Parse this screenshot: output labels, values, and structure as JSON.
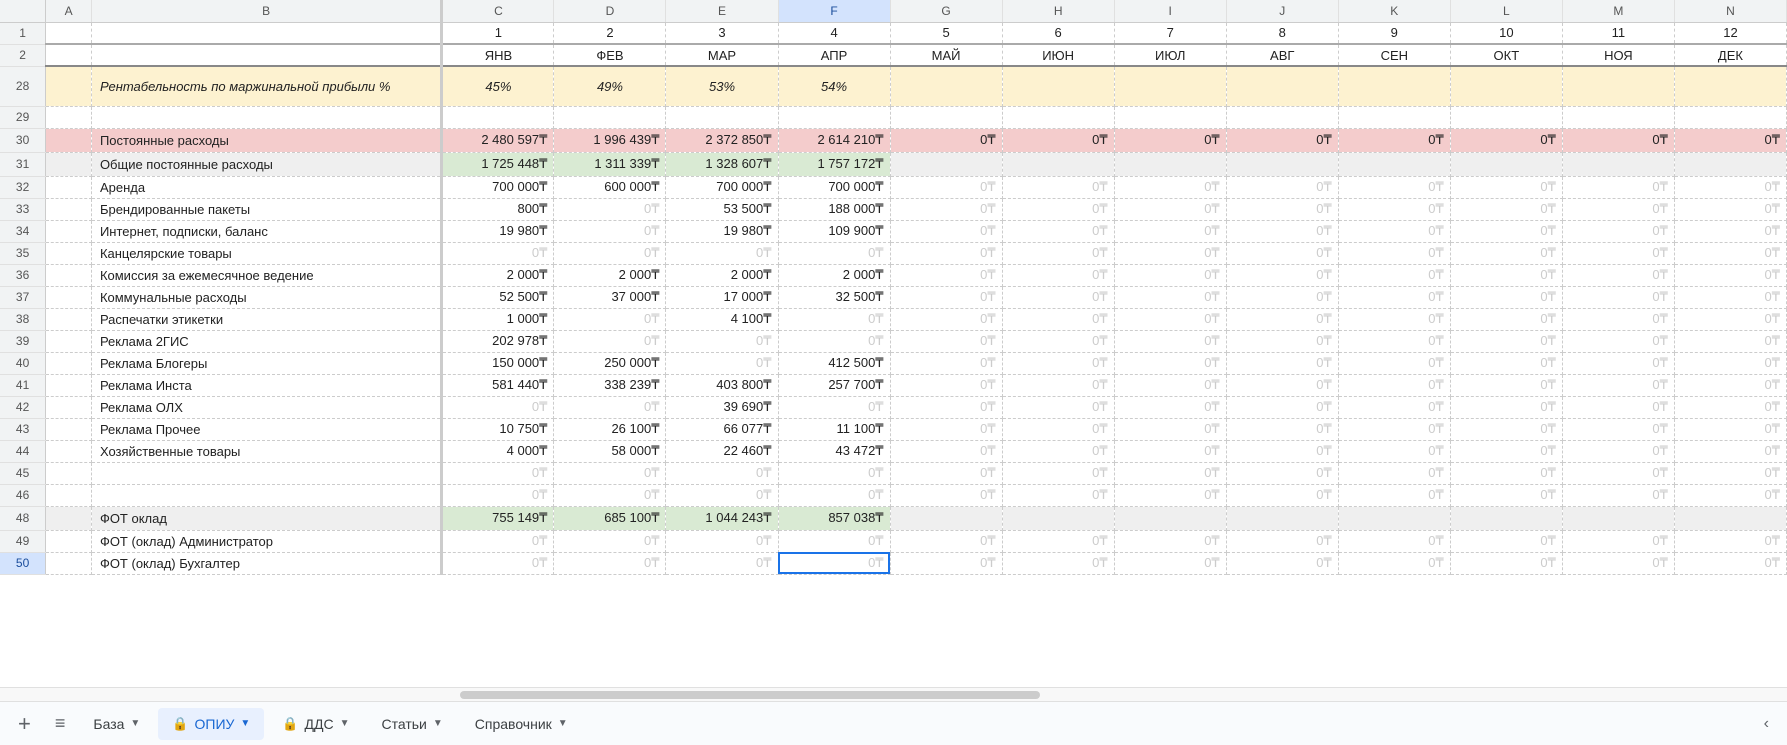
{
  "columns": [
    "A",
    "B",
    "C",
    "D",
    "E",
    "F",
    "G",
    "H",
    "I",
    "J",
    "K",
    "L",
    "M",
    "N"
  ],
  "selected_col": "F",
  "selected_row": "50",
  "header_nums": {
    "C": "1",
    "D": "2",
    "E": "3",
    "F": "4",
    "G": "5",
    "H": "6",
    "I": "7",
    "J": "8",
    "K": "9",
    "L": "10",
    "M": "11",
    "N": "12"
  },
  "header_months": {
    "C": "ЯНВ",
    "D": "ФЕВ",
    "E": "МАР",
    "F": "АПР",
    "G": "МАЙ",
    "H": "ИЮН",
    "I": "ИЮЛ",
    "J": "АВГ",
    "K": "СЕН",
    "L": "ОКТ",
    "M": "НОЯ",
    "N": "ДЕК"
  },
  "row_nums": [
    "1",
    "2",
    "28",
    "29",
    "30",
    "31",
    "32",
    "33",
    "34",
    "35",
    "36",
    "37",
    "38",
    "39",
    "40",
    "41",
    "42",
    "43",
    "44",
    "45",
    "46",
    "48",
    "49",
    "50"
  ],
  "rows": {
    "28": {
      "label": "Рентабельность по маржинальной прибыли %",
      "vals": {
        "C": "45%",
        "D": "49%",
        "E": "53%",
        "F": "54%"
      },
      "class": "yellow-row",
      "italic": true,
      "center": true
    },
    "29": {
      "label": "",
      "vals": {}
    },
    "30": {
      "label": "Постоянные расходы",
      "vals": {
        "C": "2 480 597₸",
        "D": "1 996 439₸",
        "E": "2 372 850₸",
        "F": "2 614 210₸",
        "G": "0₸",
        "H": "0₸",
        "I": "0₸",
        "J": "0₸",
        "K": "0₸",
        "L": "0₸",
        "M": "0₸",
        "N": "0₸"
      },
      "class": "pink-row"
    },
    "31": {
      "label": "Общие постоянные расходы",
      "vals": {
        "C": "1 725 448₸",
        "D": "1 311 339₸",
        "E": "1 328 607₸",
        "F": "1 757 172₸"
      },
      "class": "gray-row",
      "green": [
        "C",
        "D",
        "E",
        "F"
      ]
    },
    "32": {
      "label": "Аренда",
      "vals": {
        "C": "700 000₸",
        "D": "600 000₸",
        "E": "700 000₸",
        "F": "700 000₸"
      },
      "faded": [
        "G",
        "H",
        "I",
        "J",
        "K",
        "L",
        "M",
        "N"
      ]
    },
    "33": {
      "label": "Брендированные пакеты",
      "vals": {
        "C": "800₸",
        "E": "53 500₸",
        "F": "188 000₸"
      },
      "faded": [
        "D",
        "G",
        "H",
        "I",
        "J",
        "K",
        "L",
        "M",
        "N"
      ]
    },
    "34": {
      "label": "Интернет, подписки, баланс",
      "vals": {
        "C": "19 980₸",
        "E": "19 980₸",
        "F": "109 900₸"
      },
      "faded": [
        "D",
        "G",
        "H",
        "I",
        "J",
        "K",
        "L",
        "M",
        "N"
      ]
    },
    "35": {
      "label": "Канцелярские товары",
      "vals": {},
      "faded": [
        "C",
        "D",
        "E",
        "F",
        "G",
        "H",
        "I",
        "J",
        "K",
        "L",
        "M",
        "N"
      ]
    },
    "36": {
      "label": "Комиссия за ежемесячное ведение",
      "vals": {
        "C": "2 000₸",
        "D": "2 000₸",
        "E": "2 000₸",
        "F": "2 000₸"
      },
      "faded": [
        "G",
        "H",
        "I",
        "J",
        "K",
        "L",
        "M",
        "N"
      ]
    },
    "37": {
      "label": "Коммунальные расходы",
      "vals": {
        "C": "52 500₸",
        "D": "37 000₸",
        "E": "17 000₸",
        "F": "32 500₸"
      },
      "faded": [
        "G",
        "H",
        "I",
        "J",
        "K",
        "L",
        "M",
        "N"
      ]
    },
    "38": {
      "label": "Распечатки этикетки",
      "vals": {
        "C": "1 000₸",
        "E": "4 100₸"
      },
      "faded": [
        "D",
        "F",
        "G",
        "H",
        "I",
        "J",
        "K",
        "L",
        "M",
        "N"
      ]
    },
    "39": {
      "label": "Реклама 2ГИС",
      "vals": {
        "C": "202 978₸"
      },
      "faded": [
        "D",
        "E",
        "F",
        "G",
        "H",
        "I",
        "J",
        "K",
        "L",
        "M",
        "N"
      ]
    },
    "40": {
      "label": "Реклама Блогеры",
      "vals": {
        "C": "150 000₸",
        "D": "250 000₸",
        "F": "412 500₸"
      },
      "faded": [
        "E",
        "G",
        "H",
        "I",
        "J",
        "K",
        "L",
        "M",
        "N"
      ]
    },
    "41": {
      "label": "Реклама Инста",
      "vals": {
        "C": "581 440₸",
        "D": "338 239₸",
        "E": "403 800₸",
        "F": "257 700₸"
      },
      "faded": [
        "G",
        "H",
        "I",
        "J",
        "K",
        "L",
        "M",
        "N"
      ]
    },
    "42": {
      "label": "Реклама ОЛХ",
      "vals": {
        "E": "39 690₸"
      },
      "faded": [
        "C",
        "D",
        "F",
        "G",
        "H",
        "I",
        "J",
        "K",
        "L",
        "M",
        "N"
      ]
    },
    "43": {
      "label": "Реклама Прочее",
      "vals": {
        "C": "10 750₸",
        "D": "26 100₸",
        "E": "66 077₸",
        "F": "11 100₸"
      },
      "faded": [
        "G",
        "H",
        "I",
        "J",
        "K",
        "L",
        "M",
        "N"
      ]
    },
    "44": {
      "label": "Хозяйственные товары",
      "vals": {
        "C": "4 000₸",
        "D": "58 000₸",
        "E": "22 460₸",
        "F": "43 472₸"
      },
      "faded": [
        "G",
        "H",
        "I",
        "J",
        "K",
        "L",
        "M",
        "N"
      ]
    },
    "45": {
      "label": "",
      "vals": {},
      "faded": [
        "C",
        "D",
        "E",
        "F",
        "G",
        "H",
        "I",
        "J",
        "K",
        "L",
        "M",
        "N"
      ]
    },
    "46": {
      "label": "",
      "vals": {},
      "faded": [
        "C",
        "D",
        "E",
        "F",
        "G",
        "H",
        "I",
        "J",
        "K",
        "L",
        "M",
        "N"
      ]
    },
    "48": {
      "label": "ФОТ оклад",
      "vals": {
        "C": "755 149₸",
        "D": "685 100₸",
        "E": "1 044 243₸",
        "F": "857 038₸"
      },
      "class": "gray-row",
      "green": [
        "C",
        "D",
        "E",
        "F"
      ]
    },
    "49": {
      "label": "ФОТ (оклад) Администратор",
      "vals": {},
      "faded": [
        "C",
        "D",
        "E",
        "F",
        "G",
        "H",
        "I",
        "J",
        "K",
        "L",
        "M",
        "N"
      ]
    },
    "50": {
      "label": "ФОТ (оклад) Бухгалтер",
      "vals": {},
      "faded": [
        "C",
        "D",
        "E",
        "F",
        "G",
        "H",
        "I",
        "J",
        "K",
        "L",
        "M",
        "N"
      ],
      "selected": "F"
    }
  },
  "faded_zero": "0₸",
  "tabs": [
    {
      "label": "База",
      "lock": false,
      "active": false
    },
    {
      "label": "ОПИУ",
      "lock": true,
      "active": true
    },
    {
      "label": "ДДС",
      "lock": true,
      "active": false
    },
    {
      "label": "Статьи",
      "lock": false,
      "active": false
    },
    {
      "label": "Справочник",
      "lock": false,
      "active": false
    }
  ]
}
